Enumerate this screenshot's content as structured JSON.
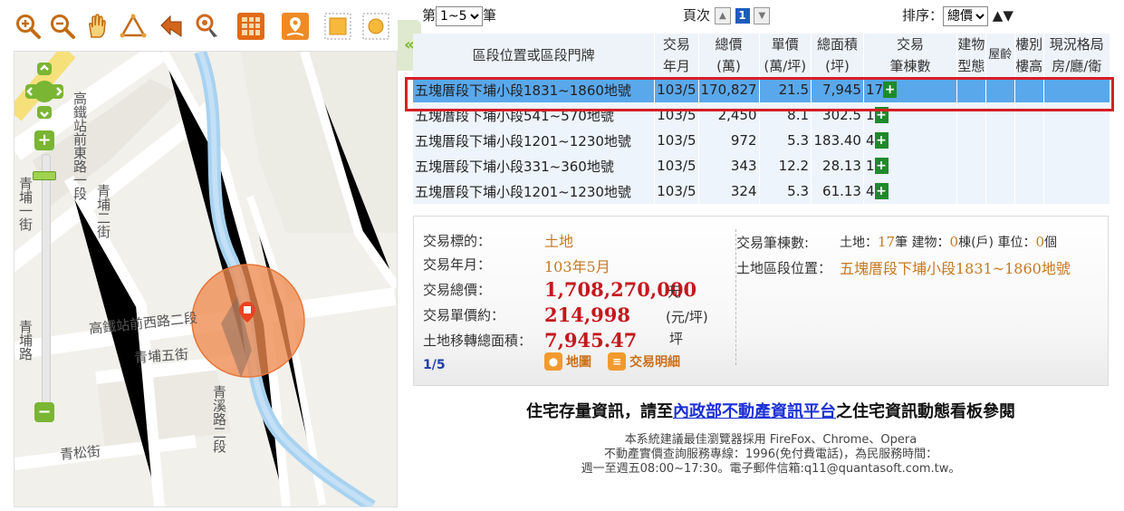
{
  "toolbar": {
    "icons": [
      "zoom-in-icon",
      "zoom-out-icon",
      "pan-hand-icon",
      "measure-area-icon",
      "back-arrow-icon",
      "locate-pin-icon",
      "table-layer-icon",
      "map-pin-icon",
      "grid-layer-icon",
      "sun-layer-icon"
    ]
  },
  "map": {
    "labels": {
      "road1": "高鐵站前東路一段",
      "road2": "高鐵站前西路二段",
      "road3": "青埔五街",
      "road4": "青松街",
      "road5": "青埔二街",
      "road6": "青埔一街",
      "road7": "青埔路",
      "road8": "青溪路二段"
    },
    "zoom_plus": "+",
    "zoom_minus": "−"
  },
  "controls": {
    "prefix": "第",
    "range_value": "1~5",
    "suffix": "筆",
    "page_label": "頁次",
    "page_current": "1",
    "sort_label": "排序：",
    "sort_value": "總價",
    "sort_up": "▲",
    "sort_down": "▼"
  },
  "table": {
    "headers": {
      "location": "區段位置或區段門牌",
      "date1": "交易",
      "date2": "年月",
      "total1": "總價",
      "total2": "(萬)",
      "unit1": "單價",
      "unit2": "(萬/坪)",
      "area1": "總面積",
      "area2": "(坪)",
      "count1": "交易",
      "count2": "筆棟數",
      "btype1": "建物",
      "btype2": "型態",
      "age": "屋齡",
      "floor1": "樓別",
      "floor2": "樓高",
      "layout1": "現況格局",
      "layout2": "房/廳/衛"
    },
    "rows": [
      {
        "location": "五塊厝段下埔小段1831~1860地號",
        "date": "103/5",
        "total": "170,827",
        "unit": "21.5",
        "area": "7,945",
        "count": "17"
      },
      {
        "location": "五塊厝段下埔小段541~570地號",
        "date": "103/5",
        "total": "2,450",
        "unit": "8.1",
        "area": "302.5",
        "count": "1"
      },
      {
        "location": "五塊厝段下埔小段1201~1230地號",
        "date": "103/5",
        "total": "972",
        "unit": "5.3",
        "area": "183.40",
        "count": "4"
      },
      {
        "location": "五塊厝段下埔小段331~360地號",
        "date": "103/5",
        "total": "343",
        "unit": "12.2",
        "area": "28.13",
        "count": "1"
      },
      {
        "location": "五塊厝段下埔小段1201~1230地號",
        "date": "103/5",
        "total": "324",
        "unit": "5.3",
        "area": "61.13",
        "count": "4"
      }
    ],
    "plus": "+"
  },
  "detail": {
    "target_label": "交易標的：",
    "target_value": "土地",
    "date_label": "交易年月：",
    "date_value": "103年5月",
    "total_label": "交易總價：",
    "total_value": "1,708,270,000",
    "total_unit": "元",
    "unit_label": "交易單價約：",
    "unit_value": "214,998",
    "unit_unit": "(元/坪)",
    "area_label": "土地移轉總面積：",
    "area_value": "7,945.47",
    "area_unit": "坪",
    "page": "1/5",
    "map_btn": "地圖",
    "detail_btn": "交易明細",
    "count_label": "交易筆棟數:",
    "land_label": "土地：",
    "land_value": "17",
    "land_unit": "筆",
    "bldg_label": "建物：",
    "bldg_value": "0",
    "bldg_unit": "棟(戶)",
    "park_label": "車位：",
    "park_value": "0",
    "park_unit": "個",
    "loc_label": "土地區段位置：",
    "loc_value": "五塊厝段下埔小段1831~1860地號"
  },
  "footer": {
    "notice_pre": "住宅存量資訊，請至",
    "notice_link": "內政部不動產資訊平台",
    "notice_post": "之住宅資訊動態看板參閱",
    "line1": "本系統建議最佳瀏覽器採用 FireFox、Chrome、Opera",
    "line2": "不動產實價查詢服務專線：1996(免付費電話)，為民服務時間：",
    "line3": "週一至週五08:00~17:30。電子郵件信箱:q11@quantasoft.com.tw。"
  }
}
